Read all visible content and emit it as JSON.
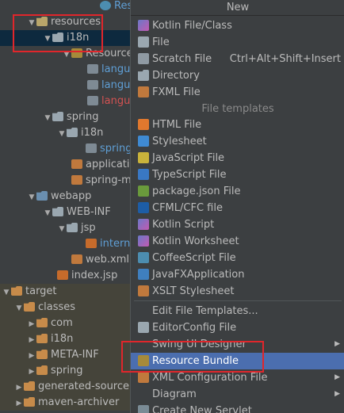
{
  "tree": {
    "top_partial": "Res",
    "resources": "resources",
    "i18n": "i18n",
    "resource_bundle": "Resource",
    "lang1": "langua",
    "lang2": "langua",
    "lang3": "langua",
    "spring": "spring",
    "spring_i18n": "i18n",
    "spring_file": "spring",
    "application": "applicatio",
    "spring_m": "spring-m",
    "webapp": "webapp",
    "web_inf": "WEB-INF",
    "jsp": "jsp",
    "internal": "interna",
    "web_xml": "web.xml",
    "index_jsp": "index.jsp",
    "target": "target",
    "classes": "classes",
    "com": "com",
    "t_i18n": "i18n",
    "meta_inf": "META-INF",
    "t_spring": "spring",
    "generated_sources": "generated-source",
    "maven_archiver": "maven-archiver"
  },
  "menu": {
    "title": "New",
    "kotlin_file": "Kotlin File/Class",
    "file": "File",
    "scratch_file": "Scratch File",
    "scratch_shortcut": "Ctrl+Alt+Shift+Insert",
    "directory": "Directory",
    "fxml_file": "FXML File",
    "section_templates": "File templates",
    "html_file": "HTML File",
    "stylesheet": "Stylesheet",
    "javascript_file": "JavaScript File",
    "typescript_file": "TypeScript File",
    "package_json": "package.json File",
    "cfml_file": "CFML/CFC file",
    "kotlin_script": "Kotlin Script",
    "kotlin_worksheet": "Kotlin Worksheet",
    "coffeescript_file": "CoffeeScript File",
    "javafx_app": "JavaFXApplication",
    "xslt_stylesheet": "XSLT Stylesheet",
    "edit_templates": "Edit File Templates...",
    "editorconfig_file": "EditorConfig File",
    "swing_designer": "Swing UI Designer",
    "resource_bundle": "Resource Bundle",
    "xml_config": "XML Configuration File",
    "diagram": "Diagram",
    "create_servlet": "Create New Servlet"
  },
  "colors": {
    "background": "#3c3f41",
    "selection": "#4b6eaf",
    "annotation": "#e0262b"
  }
}
